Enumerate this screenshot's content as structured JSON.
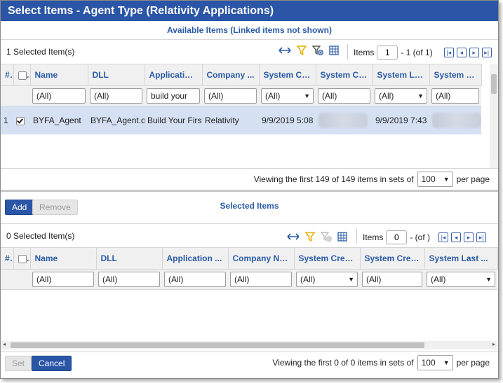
{
  "dialog": {
    "title": "Select Items - Agent Type (Relativity Applications)"
  },
  "available": {
    "heading": "Available Items (Linked items not shown)",
    "selected_count": "1  Selected Item(s)",
    "pager": {
      "items_label": "Items",
      "page_value": "1",
      "range_text": "- 1 (of 1)"
    },
    "columns": [
      "#",
      "",
      "Name",
      "DLL",
      "Applicatio.",
      "Company ...",
      "System Cr...",
      "System Cr...",
      "System La...",
      "System La..."
    ],
    "filters": [
      "(All)",
      "(All)",
      "build your",
      "(All)",
      "(All)",
      "(All)",
      "(All)",
      "(All)"
    ],
    "rows": [
      {
        "num": "1",
        "name": "BYFA_Agent",
        "dll": "BYFA_Agent.d",
        "application": "Build Your Firs",
        "company": "Relativity",
        "created_on": "9/9/2019 5:08",
        "modified_on": "9/9/2019 7:43 I"
      }
    ],
    "viewing_text": "Viewing the first 149 of 149 items in sets of",
    "page_size": "100",
    "per_page": "per page"
  },
  "selected": {
    "add_label": "Add",
    "remove_label": "Remove",
    "heading": "Selected Items",
    "selected_count": "0  Selected Item(s)",
    "pager": {
      "items_label": "Items",
      "page_value": "0",
      "range_text": "-  (of )"
    },
    "columns": [
      "#",
      "",
      "Name",
      "DLL",
      "Application ...",
      "Company Na...",
      "System Crea...",
      "System Crea...",
      "System Last ..."
    ],
    "filters": [
      "(All)",
      "(All)",
      "(All)",
      "(All)",
      "(All)",
      "(All)",
      "(All)"
    ],
    "viewing_text": "Viewing the first 0 of 0 items in sets of",
    "page_size": "100",
    "per_page": "per page"
  },
  "footer": {
    "set_label": "Set",
    "cancel_label": "Cancel"
  },
  "colors": {
    "accent": "#2b55a6",
    "header_text": "#2a5ba8",
    "selected_row": "#d5e0f3",
    "filter_icon": "#e8b000"
  }
}
